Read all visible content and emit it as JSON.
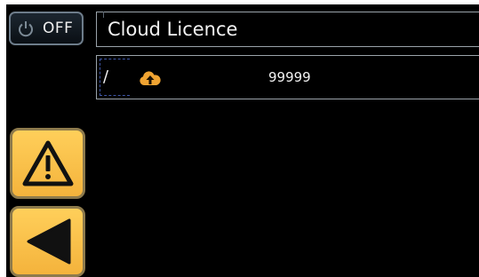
{
  "power": {
    "label": "OFF",
    "icon": "power-icon"
  },
  "header": {
    "title": "Cloud Licence"
  },
  "licence_row": {
    "cursor": "/",
    "icon": "cloud-upload-icon",
    "value": "99999"
  },
  "side_buttons": [
    {
      "icon": "warning-icon"
    },
    {
      "icon": "back-arrow-icon"
    }
  ],
  "colors": {
    "screen_bg": "#000000",
    "button_amber": "#f9bf45",
    "cloud_orange": "#f0a432",
    "border_gray": "#9aa3aa"
  }
}
